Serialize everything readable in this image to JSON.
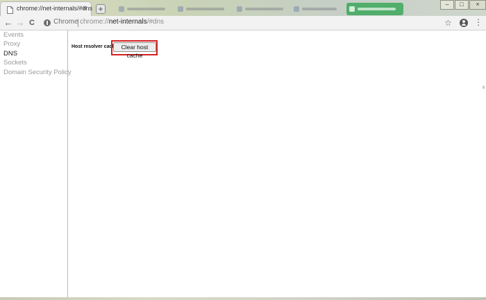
{
  "tabs": {
    "active_title": "chrome://net-internals/#dns",
    "close_symbol": "×",
    "new_tab_symbol": "+"
  },
  "window_controls": {
    "minimize": "–",
    "maximize": "□",
    "close": "×"
  },
  "toolbar": {
    "back_symbol": "←",
    "forward_symbol": "→",
    "reload_symbol": "C",
    "site_label": "Chrome",
    "url_scheme": "chrome://",
    "url_host": "net-internals",
    "url_path": "/#dns",
    "star_symbol": "☆",
    "menu_symbol": "⋮"
  },
  "sidebar": {
    "items": [
      {
        "label": "Events"
      },
      {
        "label": "Proxy"
      },
      {
        "label": "DNS"
      },
      {
        "label": "Sockets"
      },
      {
        "label": "Domain Security Policy"
      }
    ],
    "active": "DNS"
  },
  "main": {
    "cache_label": "Host resolver cache",
    "clear_button": "Clear host cache"
  },
  "colors": {
    "highlight": "#d41f1f",
    "active_text": "#222222",
    "inactive_text": "#9a9a9a"
  },
  "icons": [
    "page-icon",
    "close-icon",
    "new-tab-icon",
    "back-icon",
    "forward-icon",
    "reload-icon",
    "site-info-icon",
    "star-icon",
    "account-icon",
    "menu-icon"
  ]
}
